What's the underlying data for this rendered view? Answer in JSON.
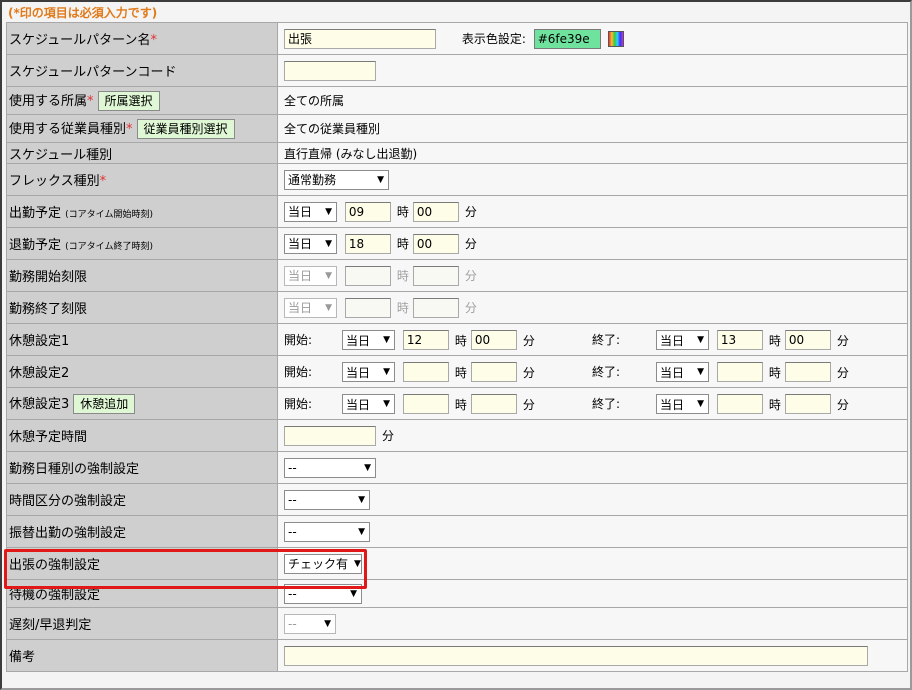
{
  "notice": "(*印の項目は必須入力です)",
  "required_mark": "*",
  "colors": {
    "accent_green": "#6fe39e",
    "required": "#e03030",
    "highlight": "#e01818"
  },
  "rows": {
    "pattern_name": {
      "label": "スケジュールパターン名",
      "value": "出張",
      "color_label": "表示色設定:",
      "color_value": "#6fe39e",
      "palette_icon": "palette-icon"
    },
    "pattern_code": {
      "label": "スケジュールパターンコード",
      "value": ""
    },
    "department": {
      "label": "使用する所属",
      "button": "所属選択",
      "value": "全ての所属"
    },
    "emp_type": {
      "label": "使用する従業員種別",
      "button": "従業員種別選択",
      "value": "全ての従業員種別"
    },
    "schedule_type": {
      "label": "スケジュール種別",
      "value": "直行直帰 (みなし出退勤)"
    },
    "flex_type": {
      "label": "フレックス種別",
      "select": "通常勤務"
    },
    "start_plan": {
      "label": "出勤予定",
      "sub": "(コアタイム開始時刻)",
      "day": "当日",
      "hour": "09",
      "min": "00"
    },
    "end_plan": {
      "label": "退勤予定",
      "sub": "(コアタイム終了時刻)",
      "day": "当日",
      "hour": "18",
      "min": "00"
    },
    "work_start_limit": {
      "label": "勤務開始刻限",
      "day": "当日",
      "hour": "",
      "min": ""
    },
    "work_end_limit": {
      "label": "勤務終了刻限",
      "day": "当日",
      "hour": "",
      "min": ""
    },
    "break1": {
      "label": "休憩設定1",
      "start_day": "当日",
      "start_hour": "12",
      "start_min": "00",
      "end_day": "当日",
      "end_hour": "13",
      "end_min": "00"
    },
    "break2": {
      "label": "休憩設定2",
      "start_day": "当日",
      "start_hour": "",
      "start_min": "",
      "end_day": "当日",
      "end_hour": "",
      "end_min": ""
    },
    "break3": {
      "label": "休憩設定3",
      "button": "休憩追加",
      "start_day": "当日",
      "start_hour": "",
      "start_min": "",
      "end_day": "当日",
      "end_hour": "",
      "end_min": ""
    },
    "break_planned": {
      "label": "休憩予定時間",
      "value": ""
    },
    "workday_force": {
      "label": "勤務日種別の強制設定",
      "select": "--"
    },
    "time_div_force": {
      "label": "時間区分の強制設定",
      "select": "--"
    },
    "transfer_force": {
      "label": "振替出勤の強制設定",
      "select": "--"
    },
    "trip_force": {
      "label": "出張の強制設定",
      "select": "チェック有"
    },
    "standby_force": {
      "label": "待機の強制設定",
      "select": "--"
    },
    "late_judge": {
      "label": "遅刻/早退判定",
      "select": "--"
    },
    "remarks": {
      "label": "備考",
      "value": ""
    }
  },
  "units": {
    "hour": "時",
    "minute": "分",
    "start": "開始:",
    "end": "終了:"
  }
}
